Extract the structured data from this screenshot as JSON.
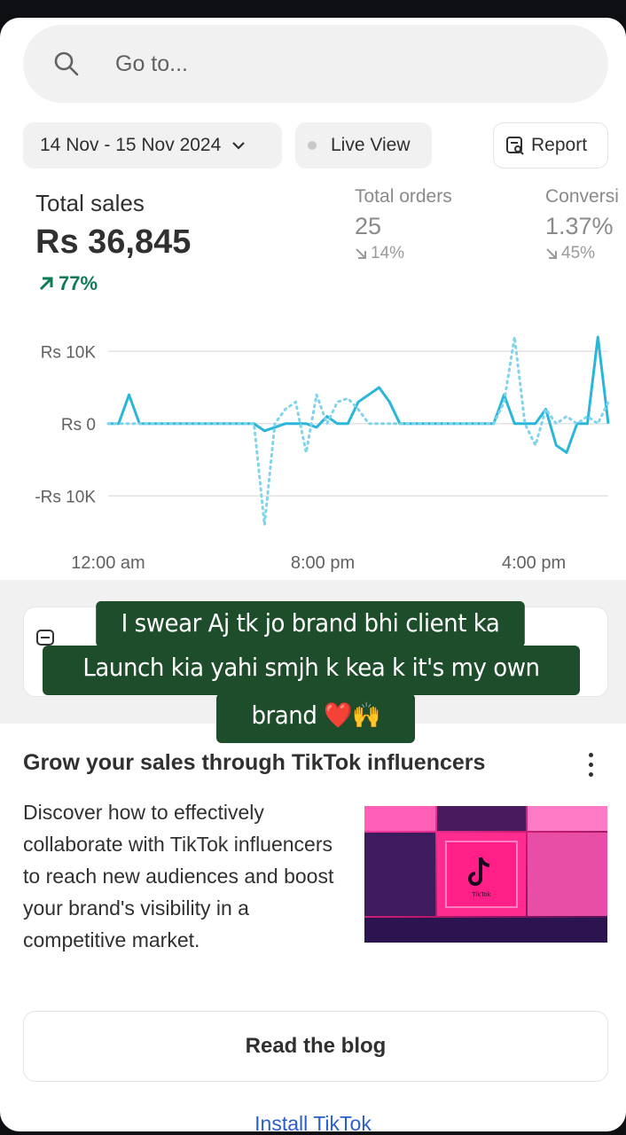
{
  "search": {
    "placeholder": "Go to..."
  },
  "toolbar": {
    "date_range": "14 Nov - 15 Nov 2024",
    "live_view_label": "Live View",
    "report_label": "Report"
  },
  "metrics": {
    "total_sales": {
      "label": "Total sales",
      "value": "Rs 36,845",
      "change": "77%",
      "trend": "up"
    },
    "total_orders": {
      "label": "Total orders",
      "value": "25",
      "change": "14%",
      "trend": "down"
    },
    "conversion": {
      "label": "Conversi",
      "value": "1.37%",
      "change": "45%",
      "trend": "down"
    }
  },
  "chart_data": {
    "type": "line",
    "y_ticks": [
      "Rs 10K",
      "Rs 0",
      "-Rs 10K"
    ],
    "x_ticks": [
      "12:00 am",
      "8:00 pm",
      "4:00 pm"
    ],
    "ylim": [
      -15000,
      12000
    ],
    "grid": true,
    "series": [
      {
        "style": "solid",
        "color": "#29b6d9",
        "x": [
          0,
          1,
          2,
          3,
          4,
          5,
          6,
          7,
          8,
          9,
          10,
          11,
          12,
          13,
          14,
          15,
          16,
          17,
          18,
          19,
          20,
          21,
          22,
          23,
          24,
          25,
          26,
          27,
          28,
          29,
          30,
          31,
          32,
          33,
          34,
          35,
          36,
          37,
          38,
          39,
          40,
          41,
          42,
          43,
          44,
          45,
          46,
          47,
          48
        ],
        "values": [
          0,
          0,
          4000,
          0,
          0,
          0,
          0,
          0,
          0,
          0,
          0,
          0,
          0,
          0,
          0,
          -1000,
          -500,
          0,
          0,
          0,
          -500,
          1000,
          0,
          0,
          3000,
          4000,
          5000,
          3000,
          0,
          0,
          0,
          0,
          0,
          0,
          0,
          0,
          0,
          0,
          4000,
          0,
          0,
          0,
          2000,
          -3000,
          -4000,
          0,
          0,
          12000,
          0
        ]
      },
      {
        "style": "dotted",
        "color": "#7fd3ea",
        "x": [
          0,
          1,
          2,
          3,
          4,
          5,
          6,
          7,
          8,
          9,
          10,
          11,
          12,
          13,
          14,
          15,
          16,
          17,
          18,
          19,
          20,
          21,
          22,
          23,
          24,
          25,
          26,
          27,
          28,
          29,
          30,
          31,
          32,
          33,
          34,
          35,
          36,
          37,
          38,
          39,
          40,
          41,
          42,
          43,
          44,
          45,
          46,
          47,
          48
        ],
        "values": [
          0,
          0,
          0,
          0,
          0,
          0,
          0,
          0,
          0,
          0,
          0,
          0,
          0,
          0,
          0,
          -14000,
          0,
          2000,
          3000,
          -4000,
          4000,
          0,
          3000,
          3500,
          2000,
          0,
          0,
          0,
          0,
          0,
          0,
          0,
          0,
          0,
          0,
          0,
          0,
          0,
          3000,
          12000,
          0,
          -3000,
          2000,
          0,
          1000,
          0,
          1000,
          0,
          3000
        ]
      }
    ]
  },
  "overlay": {
    "line1": "I swear Aj tk jo brand bhi client ka",
    "line2": "Launch kia yahi smjh k kea k it's my own",
    "line3": "brand ❤️🙌"
  },
  "blog": {
    "title": "Grow your sales through TikTok influencers",
    "description": "Discover how to effectively collaborate with TikTok influencers to reach new audiences and boost your brand's visibility in a competitive market.",
    "image_label": "TikTok",
    "button_label": "Read the blog",
    "install_link": "Install TikTok"
  },
  "colors": {
    "accent_green": "#0f7a55",
    "chart_line": "#29b6d9",
    "overlay_bg": "#1e4d2b",
    "link": "#2b5fc9"
  }
}
